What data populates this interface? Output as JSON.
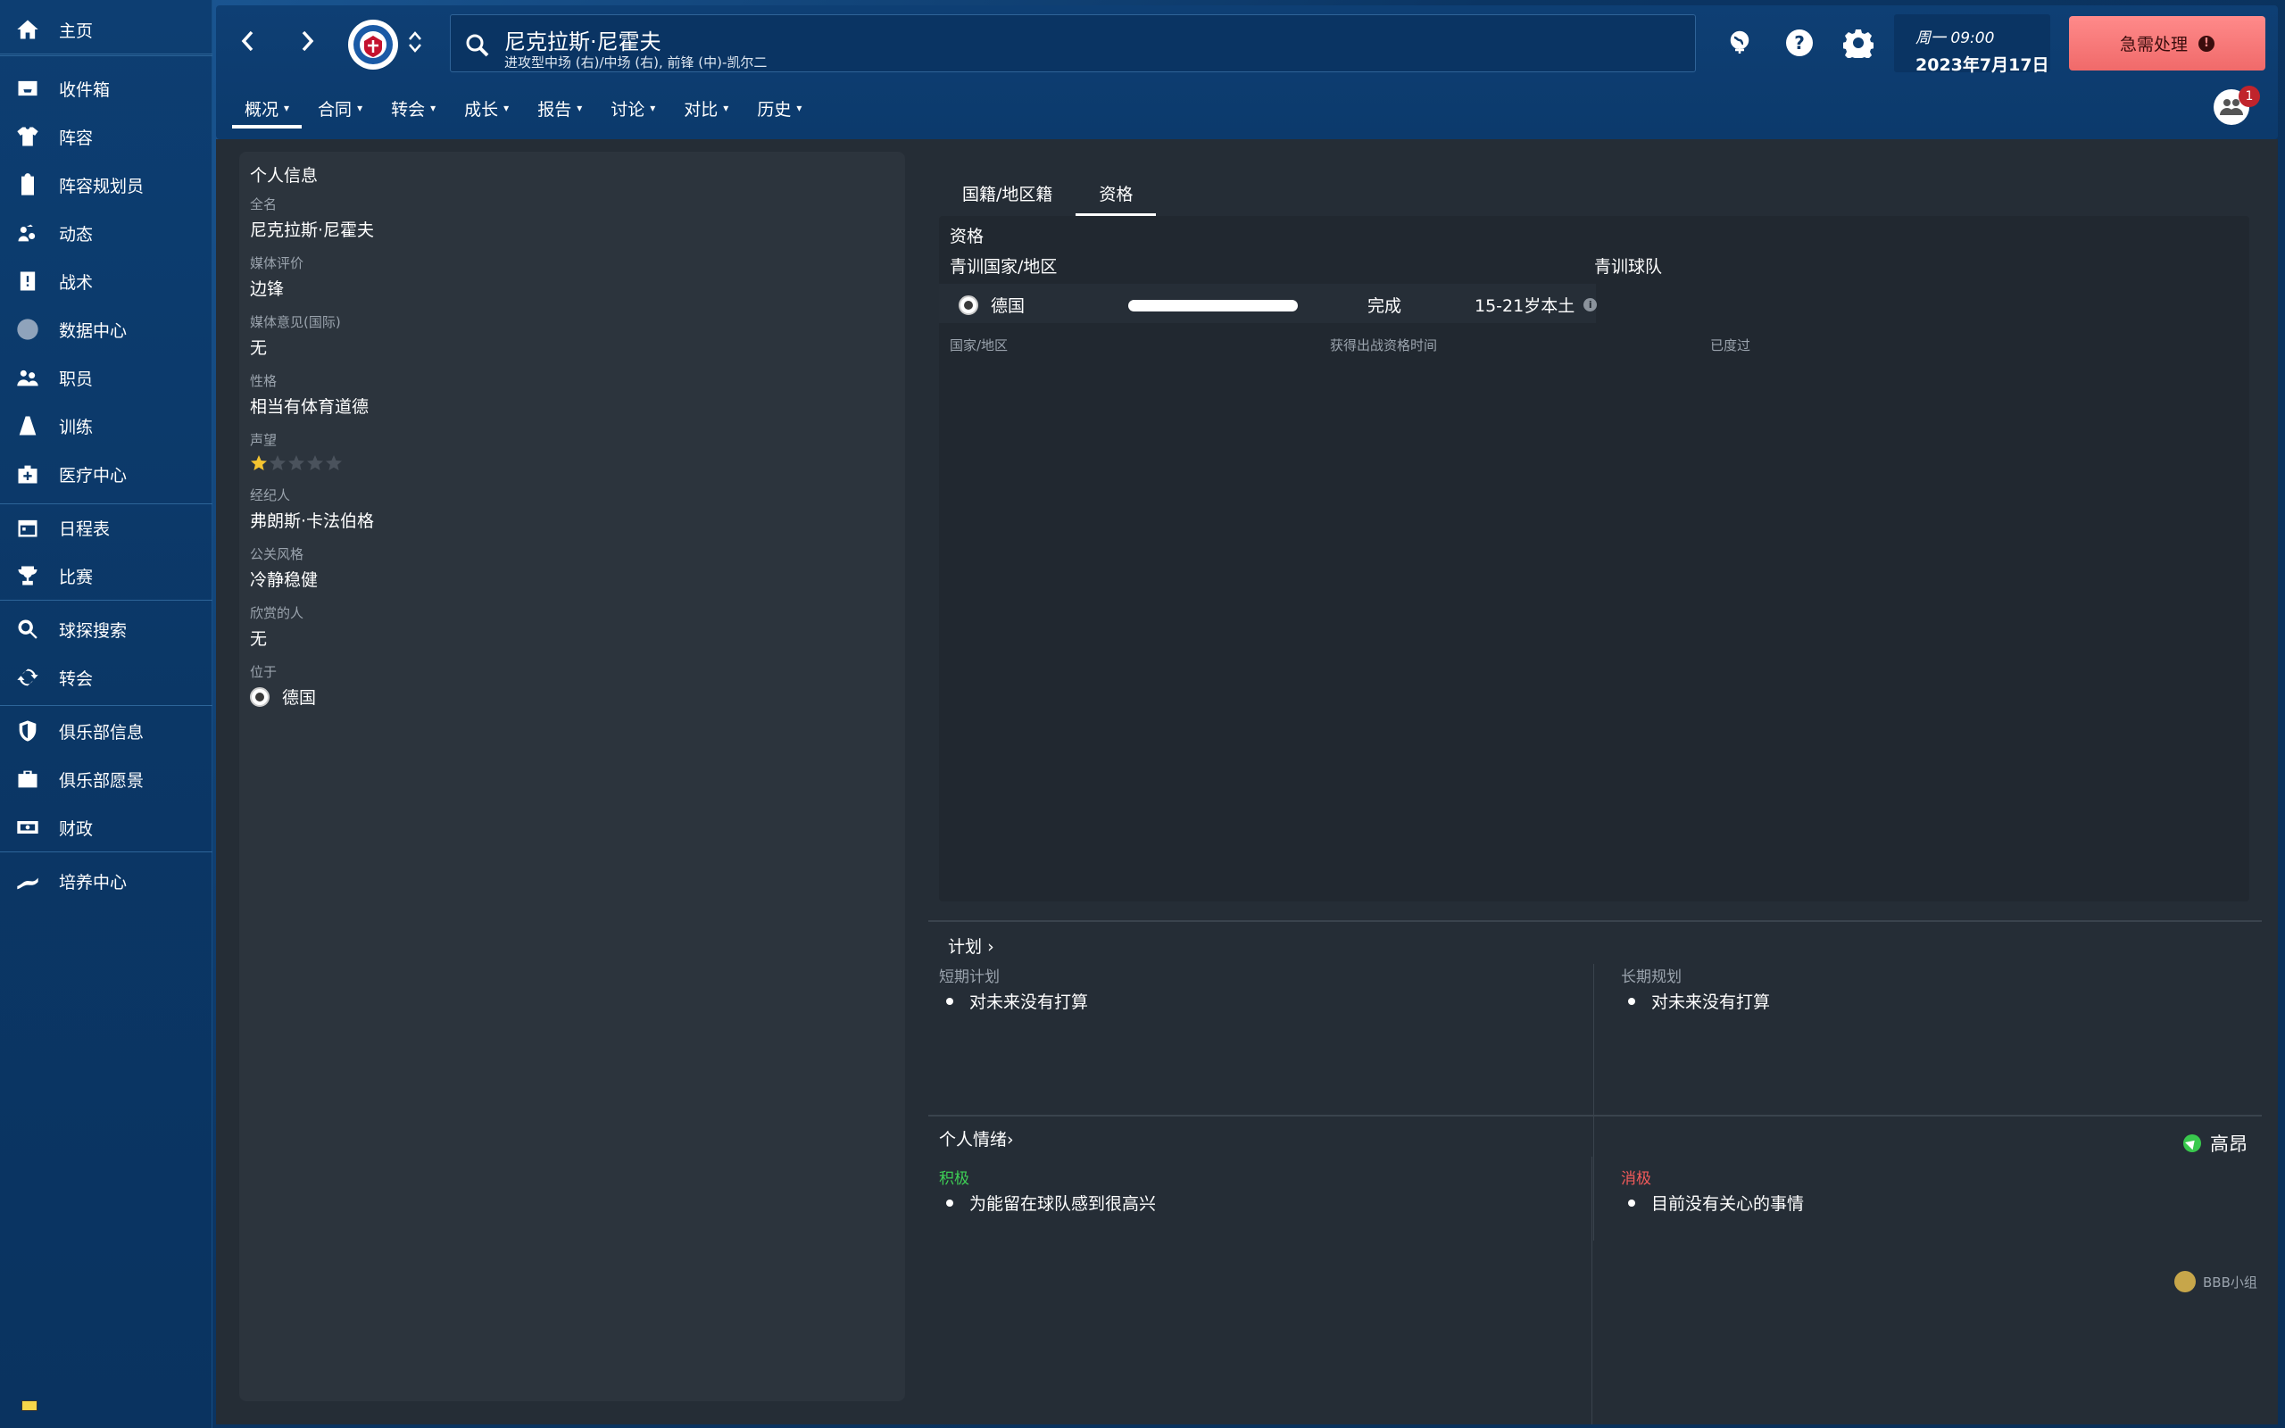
{
  "sidebar": {
    "items": [
      {
        "label": "主页",
        "icon": "home-icon"
      },
      {
        "label": "收件箱",
        "icon": "inbox-icon"
      },
      {
        "label": "阵容",
        "icon": "shirt-icon"
      },
      {
        "label": "阵容规划员",
        "icon": "clipboard-icon"
      },
      {
        "label": "动态",
        "icon": "dynamics-icon"
      },
      {
        "label": "战术",
        "icon": "tactics-icon"
      },
      {
        "label": "数据中心",
        "icon": "data-hub-icon"
      },
      {
        "label": "职员",
        "icon": "staff-icon"
      },
      {
        "label": "训练",
        "icon": "training-icon"
      },
      {
        "label": "医疗中心",
        "icon": "medical-icon"
      },
      {
        "label": "日程表",
        "icon": "calendar-icon"
      },
      {
        "label": "比赛",
        "icon": "trophy-icon"
      },
      {
        "label": "球探搜索",
        "icon": "scouting-icon"
      },
      {
        "label": "转会",
        "icon": "transfer-icon"
      },
      {
        "label": "俱乐部信息",
        "icon": "club-info-icon"
      },
      {
        "label": "俱乐部愿景",
        "icon": "club-vision-icon"
      },
      {
        "label": "财政",
        "icon": "finances-icon"
      },
      {
        "label": "培养中心",
        "icon": "development-icon"
      }
    ]
  },
  "header": {
    "player_name": "尼克拉斯·尼霍夫",
    "player_position": "进攻型中场 (右)/中场 (右), 前锋 (中)-凯尔二",
    "date_weekday": "周一 09:00",
    "date": "2023年7月17日",
    "urgent_label": "急需处理",
    "notification_count": "1",
    "tabs": [
      "概况",
      "合同",
      "转会",
      "成长",
      "报告",
      "讨论",
      "对比",
      "历史"
    ]
  },
  "personal_info": {
    "title": "个人信息",
    "fields": [
      {
        "label": "全名",
        "value": "尼克拉斯·尼霍夫"
      },
      {
        "label": "媒体评价",
        "value": "边锋"
      },
      {
        "label": "媒体意见(国际)",
        "value": "无"
      },
      {
        "label": "性格",
        "value": "相当有体育道德"
      },
      {
        "label": "声望",
        "value": ""
      },
      {
        "label": "经纪人",
        "value": "弗朗斯·卡法伯格"
      },
      {
        "label": "公关风格",
        "value": "冷静稳健"
      },
      {
        "label": "欣赏的人",
        "value": "无"
      },
      {
        "label": "位于",
        "value": "德国"
      }
    ],
    "reputation_stars": 1,
    "reputation_max": 5
  },
  "right_tabs": [
    "国籍/地区籍",
    "资格"
  ],
  "qualification": {
    "title": "资格",
    "col_youth_nation": "青训国家/地区",
    "col_youth_club": "青训球队",
    "row_nation": "德国",
    "row_status": "完成",
    "row_detail": "15-21岁本土",
    "sub_nation": "国家/地区",
    "sub_time": "获得出战资格时间",
    "sub_spent": "已度过"
  },
  "plans": {
    "title": "计划",
    "short_label": "短期计划",
    "short_item": "对未来没有打算",
    "long_label": "长期规划",
    "long_item": "对未来没有打算"
  },
  "mood": {
    "title": "个人情绪",
    "level": "高昂",
    "positive_label": "积极",
    "positive_item": "为能留在球队感到很高兴",
    "negative_label": "消极",
    "negative_item": "目前没有关心的事情"
  },
  "watermark": "ВВВ小组",
  "colors": {
    "accent_red": "#f06a6a",
    "positive": "#3ecf55",
    "negative": "#f25a5a",
    "star": "#f4c430"
  }
}
